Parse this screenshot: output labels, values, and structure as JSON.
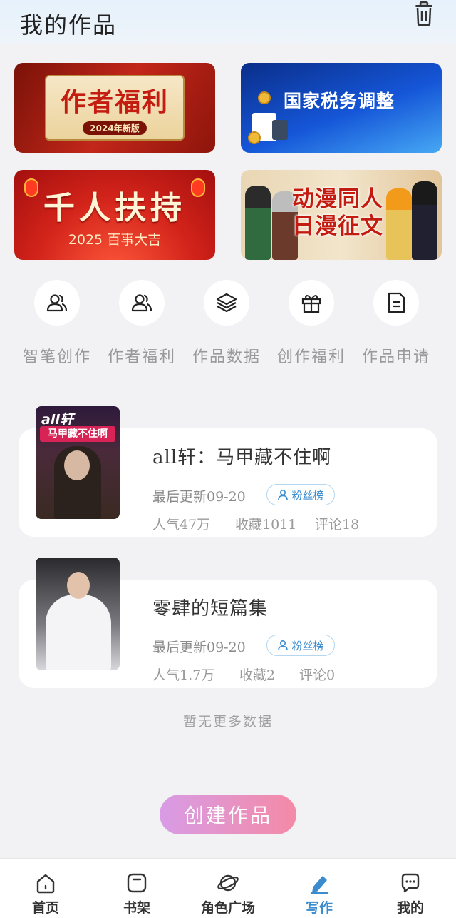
{
  "header": {
    "title": "我的作品"
  },
  "banners": [
    {
      "title": "作者福利",
      "subtitle": "2024年新版"
    },
    {
      "title": "国家税务调整"
    },
    {
      "title": "千人扶持",
      "subtitle": "2025 百事大吉"
    },
    {
      "title_line1": "动漫同人",
      "title_line2": "日漫征文"
    }
  ],
  "quick_actions": [
    {
      "label": "智笔创作",
      "icon": "users-icon"
    },
    {
      "label": "作者福利",
      "icon": "users-icon"
    },
    {
      "label": "作品数据",
      "icon": "layers-icon"
    },
    {
      "label": "创作福利",
      "icon": "gift-icon"
    },
    {
      "label": "作品申请",
      "icon": "document-icon"
    }
  ],
  "works": [
    {
      "title": "all轩：马甲藏不住啊",
      "cover_tag": "all轩",
      "cover_band": "马甲藏不住啊",
      "updated": "最后更新09-20",
      "badge": "粉丝榜",
      "popularity": "人气47万",
      "favorites": "收藏1011",
      "comments": "评论18"
    },
    {
      "title": "零肆的短篇集",
      "updated": "最后更新09-20",
      "badge": "粉丝榜",
      "popularity": "人气1.7万",
      "favorites": "收藏2",
      "comments": "评论0"
    }
  ],
  "no_more_text": "暂无更多数据",
  "create_button": "创建作品",
  "tabs": [
    {
      "label": "首页",
      "icon": "home-icon",
      "active": false
    },
    {
      "label": "书架",
      "icon": "bookshelf-icon",
      "active": false
    },
    {
      "label": "角色广场",
      "icon": "planet-icon",
      "active": false
    },
    {
      "label": "写作",
      "icon": "pen-icon",
      "active": true
    },
    {
      "label": "我的",
      "icon": "chat-icon",
      "active": false
    }
  ],
  "colors": {
    "accent": "#3a8ccf",
    "create_from": "#d89ce6",
    "create_to": "#f48aa6"
  }
}
